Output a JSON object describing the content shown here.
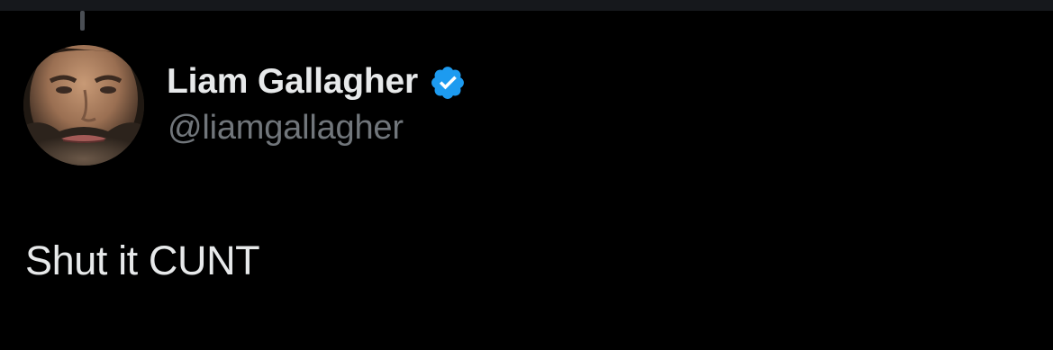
{
  "author": {
    "display_name": "Liam Gallagher",
    "handle": "@liamgallagher",
    "verified": true,
    "verified_color": "#1d9bf0",
    "avatar": "profile-photo"
  },
  "tweet": {
    "text": "Shut it CUNT"
  },
  "colors": {
    "background": "#000000",
    "primary_text": "#e7e9ea",
    "secondary_text": "#71767b"
  }
}
